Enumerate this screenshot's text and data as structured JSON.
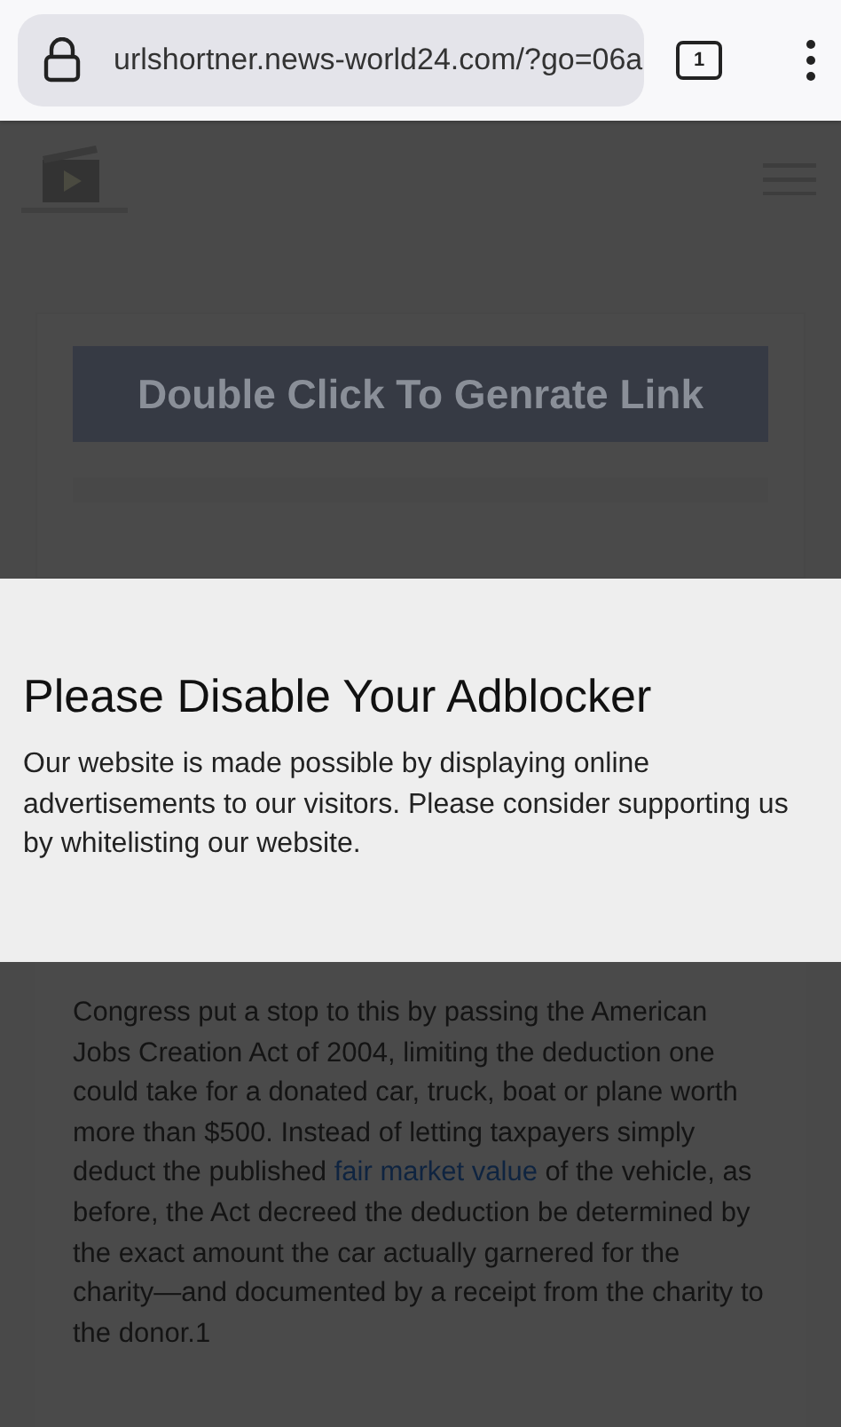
{
  "browser": {
    "url": "urlshortner.news-world24.com/?go=06a",
    "tab_count": "1"
  },
  "page": {
    "button": "Double Click To Genrate Link",
    "article": {
      "before": "Congress put a stop to this by passing the American Jobs Creation Act of 2004, limiting the deduction one could take for a donated car, truck, boat or plane worth more than $500. Instead of letting taxpayers simply deduct the published",
      "link": "fair market value",
      "after": "of the vehicle, as before, the Act decreed the deduction be determined by the exact amount the car actually garnered for the charity—and documented by a receipt from the charity to the donor.1"
    }
  },
  "modal": {
    "title": "Please Disable Your Adblocker",
    "message": "Our website is made possible by displaying online advertisements to our visitors. Please consider supporting us by whitelisting our website."
  }
}
